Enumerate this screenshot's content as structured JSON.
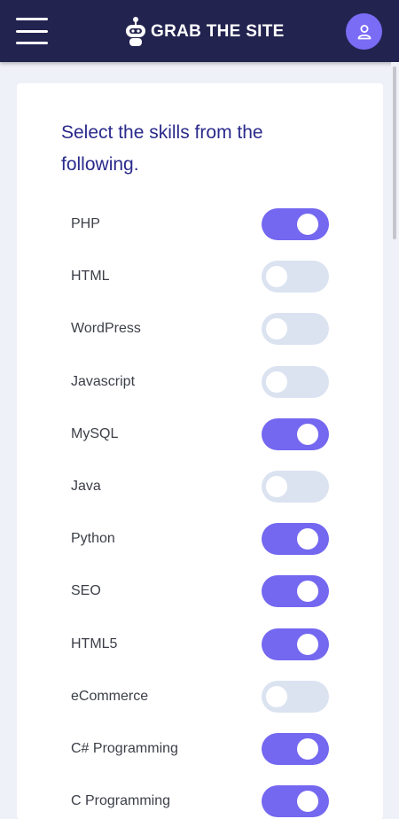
{
  "header": {
    "brand": "GRAB THE SITE",
    "menu_icon": "hamburger-icon",
    "logo_icon": "robot-logo-icon",
    "profile_icon": "user-icon"
  },
  "form": {
    "heading": "Select the skills from the following.",
    "skills": [
      {
        "label": "PHP",
        "checked": true
      },
      {
        "label": "HTML",
        "checked": false
      },
      {
        "label": "WordPress",
        "checked": false
      },
      {
        "label": "Javascript",
        "checked": false
      },
      {
        "label": "MySQL",
        "checked": true
      },
      {
        "label": "Java",
        "checked": false
      },
      {
        "label": "Python",
        "checked": true
      },
      {
        "label": "SEO",
        "checked": true
      },
      {
        "label": "HTML5",
        "checked": true
      },
      {
        "label": "eCommerce",
        "checked": false
      },
      {
        "label": "C# Programming",
        "checked": true
      },
      {
        "label": "C Programming",
        "checked": true
      }
    ]
  },
  "colors": {
    "header_bg": "#232350",
    "accent": "#7467f0",
    "toggle_off": "#dbe3f1",
    "heading_text": "#2a2a8c",
    "page_bg": "#eef1f7"
  }
}
